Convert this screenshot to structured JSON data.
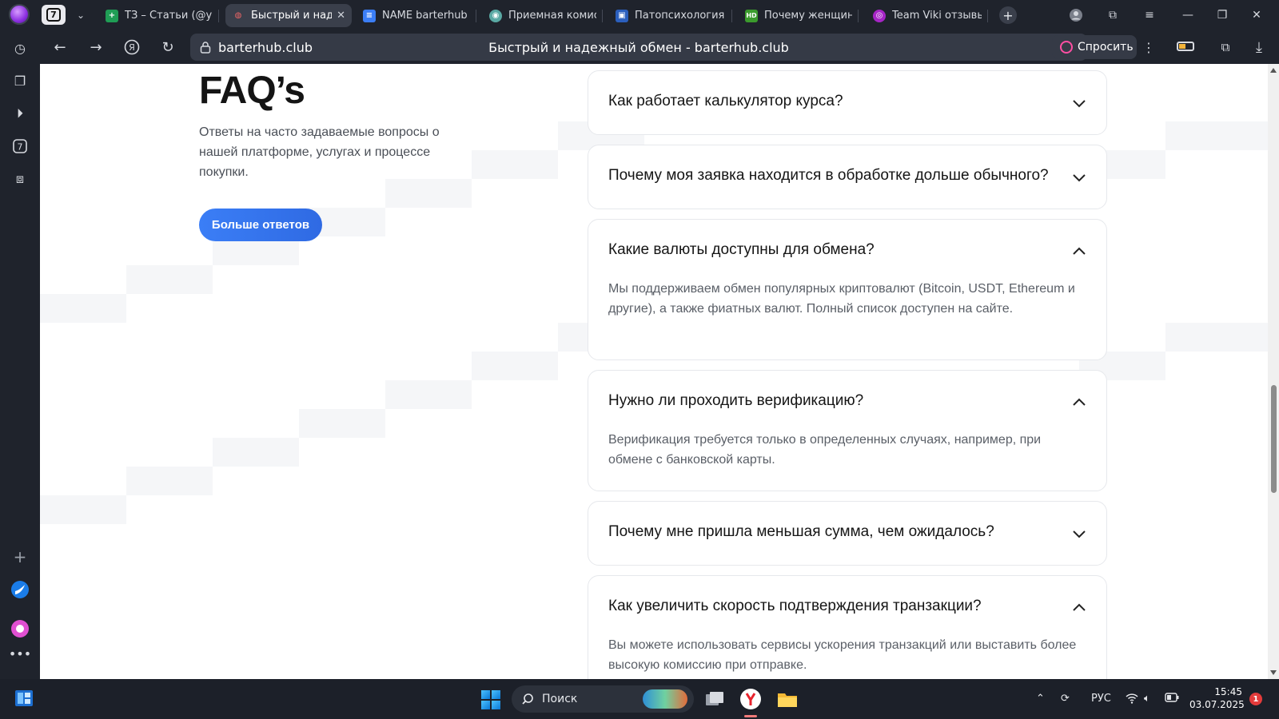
{
  "browser": {
    "tab_count": "7",
    "tabs": [
      {
        "label": "ТЗ – Статьи (@ya",
        "favicon_color": "#1f9d55",
        "favicon_text": "+"
      },
      {
        "label": "Быстрый и надежный обмен - barterhub.club",
        "favicon_color": "#3a3f4b",
        "favicon_text": "",
        "active": true
      },
      {
        "label": "NAME barterhub",
        "favicon_color": "#3b7ef6",
        "favicon_text": "≡"
      },
      {
        "label": "Приемная комиссия",
        "favicon_color": "#5aa9a4",
        "favicon_text": "◉"
      },
      {
        "label": "Патопсихология",
        "favicon_color": "#2b5fbd",
        "favicon_text": "▣"
      },
      {
        "label": "Почему женщины",
        "favicon_color": "#3b9b2d",
        "favicon_text": "HD"
      },
      {
        "label": "Team Viki отзывы",
        "favicon_color": "#a625c6",
        "favicon_text": "◎"
      }
    ],
    "url_domain": "barterhub.club",
    "page_title": "Быстрый и надежный обмен - barterhub.club",
    "ask_label": "Спросить"
  },
  "page": {
    "faq_title": "FAQ’s",
    "faq_subtitle": "Ответы на часто задаваемые вопросы о нашей платформе, услугах и процессе покупки.",
    "more_button": "Больше ответов",
    "items": [
      {
        "q": "Как работает калькулятор курса?",
        "open": false,
        "a": ""
      },
      {
        "q": "Почему моя заявка находится в обработке дольше обычного?",
        "open": false,
        "a": ""
      },
      {
        "q": "Какие валюты доступны для обмена?",
        "open": true,
        "a": "Мы поддерживаем обмен популярных криптовалют (Bitcoin, USDT, Ethereum и другие), а также фиатных валют. Полный список доступен на сайте."
      },
      {
        "q": "Нужно ли проходить верификацию?",
        "open": true,
        "a": "Верификация требуется только в определенных случаях, например, при обмене с банковской карты."
      },
      {
        "q": "Почему мне пришла меньшая сумма, чем ожидалось?",
        "open": false,
        "a": ""
      },
      {
        "q": "Как увеличить скорость подтверждения транзакции?",
        "open": true,
        "a": "Вы можете использовать сервисы ускорения транзакций или выставить более высокую комиссию при отправке."
      }
    ]
  },
  "taskbar": {
    "search_label": "Поиск",
    "language": "РУС",
    "time": "15:45",
    "date": "03.07.2025",
    "notifications": "1"
  },
  "colors": {
    "accent": "#3b7ef6",
    "chrome_bg": "#1f232c"
  }
}
